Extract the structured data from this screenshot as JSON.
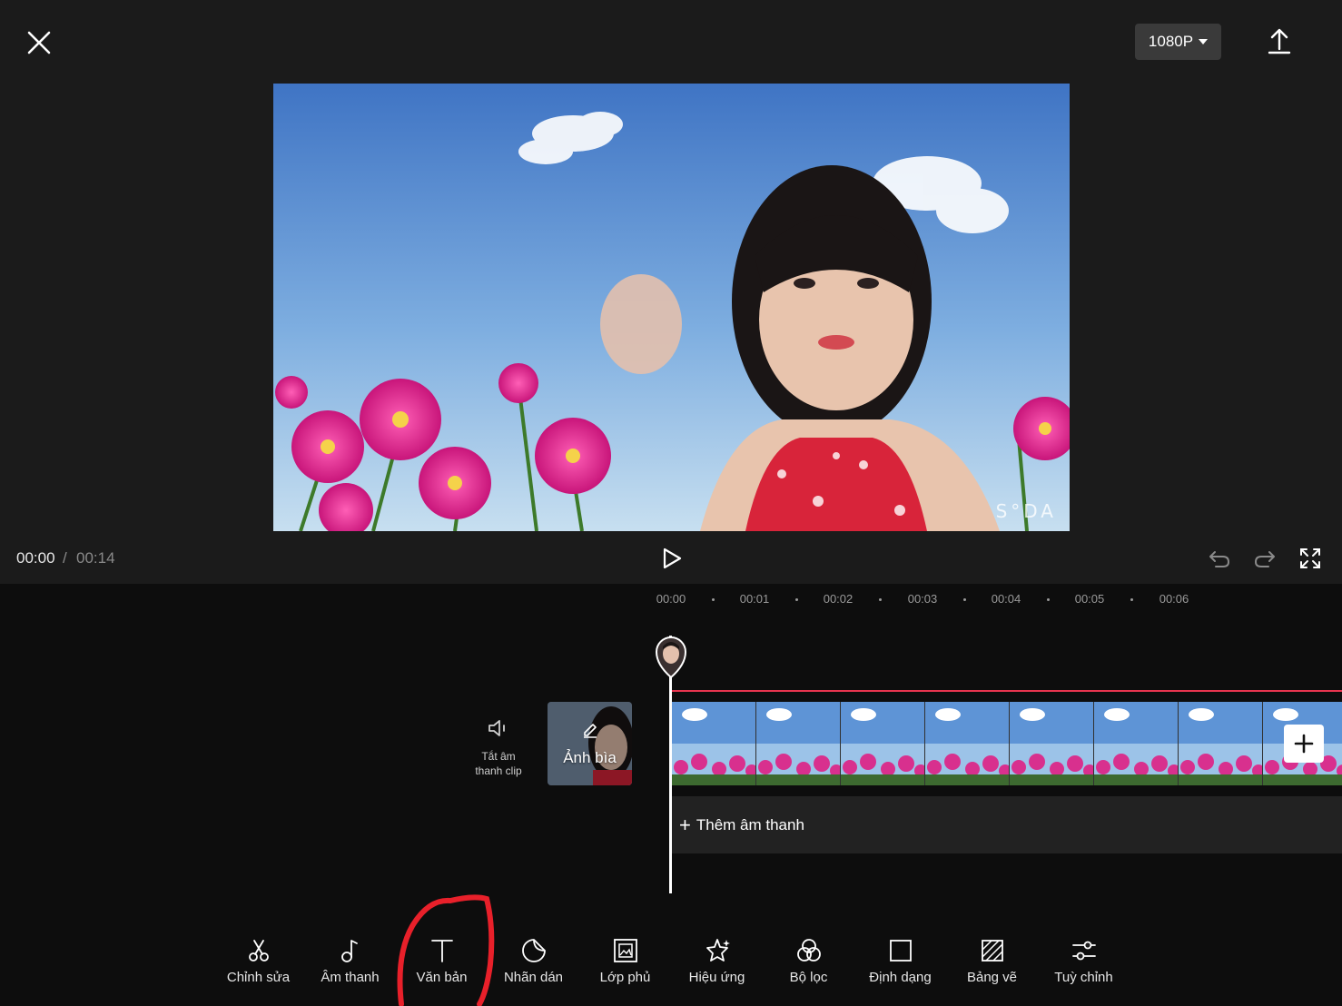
{
  "header": {
    "close_icon": "close-icon",
    "resolution": "1080P",
    "export_icon": "export-icon"
  },
  "preview": {
    "watermark": "S°DA"
  },
  "player": {
    "current_time": "00:00",
    "separator": "/",
    "total_time": "00:14"
  },
  "ruler": {
    "ticks": [
      "00:00",
      "00:01",
      "00:02",
      "00:03",
      "00:04",
      "00:05",
      "00:06"
    ]
  },
  "timeline": {
    "mute_label_line1": "Tắt âm",
    "mute_label_line2": "thanh clip",
    "cover_label": "Ảnh bìa",
    "add_audio_label": "Thêm âm thanh",
    "playhead_color": "#ffffff",
    "track_marker_color": "#e8344e"
  },
  "toolbar": {
    "items": [
      {
        "label": "Chỉnh sửa",
        "icon": "scissors-icon"
      },
      {
        "label": "Âm thanh",
        "icon": "music-note-icon"
      },
      {
        "label": "Văn bản",
        "icon": "text-icon"
      },
      {
        "label": "Nhãn dán",
        "icon": "sticker-icon"
      },
      {
        "label": "Lớp phủ",
        "icon": "overlay-icon"
      },
      {
        "label": "Hiệu ứng",
        "icon": "effects-star-icon"
      },
      {
        "label": "Bộ lọc",
        "icon": "filter-icon"
      },
      {
        "label": "Định dạng",
        "icon": "format-square-icon"
      },
      {
        "label": "Bảng vẽ",
        "icon": "canvas-icon"
      },
      {
        "label": "Tuỳ chỉnh",
        "icon": "adjust-sliders-icon"
      }
    ],
    "highlighted": "Văn bản",
    "highlight_color": "#e8202a"
  }
}
